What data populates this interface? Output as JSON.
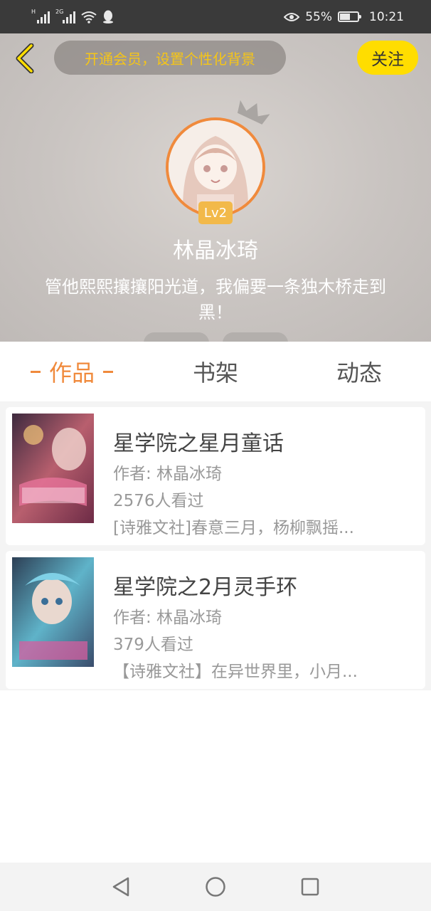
{
  "status_bar": {
    "net1": "H",
    "net2": "2G",
    "battery_percent": "55%",
    "time": "10:21",
    "icons": [
      "signal-icon",
      "wifi-icon",
      "qq-icon",
      "eye-icon",
      "battery-icon"
    ]
  },
  "header": {
    "vip_banner": "开通会员，设置个性化背景",
    "follow_label": "关注",
    "level": "Lv2",
    "username": "林晶冰琦",
    "bio": "管他熙熙攘攘阳光道，我偏要一条独木桥走到黑！"
  },
  "tabs": [
    {
      "label": "作品",
      "active": true
    },
    {
      "label": "书架",
      "active": false
    },
    {
      "label": "动态",
      "active": false
    }
  ],
  "works": [
    {
      "title": "星学院之星月童话",
      "author": "作者: 林晶冰琦",
      "views": "2576人看过",
      "desc": "[诗雅文社]春意三月，杨柳飘摇..."
    },
    {
      "title": "星学院之2月灵手环",
      "author": "作者: 林晶冰琦",
      "views": "379人看过",
      "desc": "【诗雅文社】在异世界里，小月..."
    }
  ],
  "colors": {
    "accent": "#f08a3c",
    "follow_bg": "#ffdd00",
    "vip_text": "#f5c518",
    "level_bg": "#f2b94a"
  }
}
